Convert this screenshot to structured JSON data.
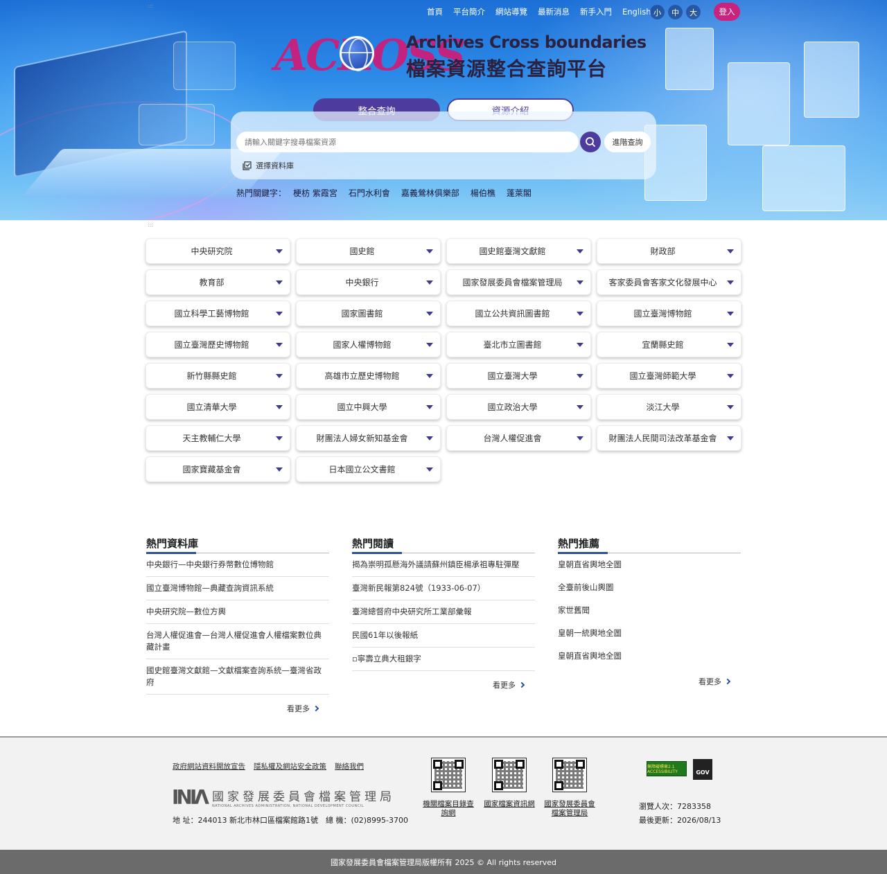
{
  "topnav": {
    "links": [
      "首頁",
      "平台簡介",
      "網站導覽",
      "最新消息",
      "新手入門",
      "English"
    ],
    "fontsize": [
      "小",
      "中",
      "大"
    ],
    "login": "登入"
  },
  "logo": {
    "brand": "ACROSS",
    "en": "Archives Cross boundaries",
    "zh": "檔案資源整合查詢平台"
  },
  "tabs": [
    "整合查詢",
    "資源介紹"
  ],
  "search": {
    "placeholder": "請輸入關鍵字搜尋檔案資源",
    "advanced": "進階查詢",
    "choose_db": "選擇資料庫"
  },
  "hot_keywords": {
    "label": "熱門關鍵字：",
    "items": [
      "梗枋 紫霞宮",
      "石門水利會",
      "嘉義鶯林俱樂部",
      "楊伯樵",
      "蓬萊閣"
    ]
  },
  "skip_marker": ":::",
  "orgs": [
    "中央研究院",
    "國史館",
    "國史館臺灣文獻館",
    "財政部",
    "教育部",
    "中央銀行",
    "國家發展委員會檔案管理局",
    "客家委員會客家文化發展中心",
    "國立科學工藝博物館",
    "國家圖書館",
    "國立公共資訊圖書館",
    "國立臺灣博物館",
    "國立臺灣歷史博物館",
    "國家人權博物館",
    "臺北市立圖書館",
    "宜蘭縣史館",
    "新竹縣縣史館",
    "高雄市立歷史博物館",
    "國立臺灣大學",
    "國立臺灣師範大學",
    "國立清華大學",
    "國立中興大學",
    "國立政治大學",
    "淡江大學",
    "天主教輔仁大學",
    "財團法人婦女新知基金會",
    "台灣人權促進會",
    "財團法人民間司法改革基金會",
    "國家寶藏基金會",
    "日本國立公文書館"
  ],
  "hot_db": {
    "title": "熱門資料庫",
    "items": [
      "中央銀行—中央銀行券幣數位博物館",
      "國立臺灣博物館—典藏查詢資訊系統",
      "中央研究院—數位方輿",
      "台灣人權促進會—台灣人權促進會人權檔案數位典藏計畫",
      "國史館臺灣文獻館—文獻檔案查詢系統—臺灣省政府"
    ],
    "more": "看更多"
  },
  "hot_read": {
    "title": "熱門閱讀",
    "items": [
      "揭為崇明孤懸海外議請蘇州鎮臣楊承祖專駐彈壓",
      "臺灣新民報第824號（1933-06-07）",
      "臺灣總督府中央研究所工業部彙報",
      "民國61年以後報紙",
      "▫寧壽立典大租銀字"
    ],
    "more": "看更多"
  },
  "hot_rec": {
    "title": "熱門推薦",
    "items": [
      "皇朝直省輿地全圖",
      "全臺前後山輿圖",
      "家世舊聞",
      "皇朝一統輿地全圖",
      "皇朝直省輿地全圖"
    ],
    "more": "看更多"
  },
  "footer": {
    "links": [
      "政府網站資料開放宣告",
      "隱私權及網站安全政策",
      "聯絡我們"
    ],
    "org_zh": "國家發展委員會檔案管理局",
    "org_en": "NATIONAL ARCHIVES ADMINISTRATION, NATIONAL DEVELOPMENT COUNCIL",
    "address": "地 址：244013 新北市林口區檔案館路1號　總 機：(02)8995-3700",
    "qr_labels": [
      "機關檔案目錄查詢網",
      "國家檔案資訊網",
      "國家發展委員會檔案管理局"
    ],
    "accessibility": "無障礙標章2.1 ACCESSIBILITY",
    "gov": "GOV",
    "visits": "瀏覽人次：7283358",
    "updated": "最後更新：2026/08/13",
    "copyright": "國家發展委員會檔案管理局版權所有 2025 © All rights reserved"
  }
}
